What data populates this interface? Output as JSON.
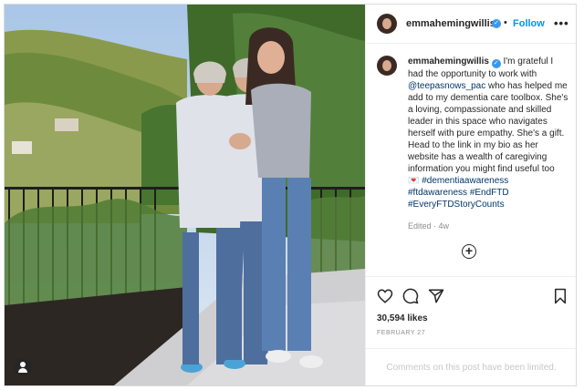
{
  "header": {
    "username": "emmahemingwillis",
    "separator": "•",
    "follow_label": "Follow",
    "more_label": "•••"
  },
  "caption": {
    "username": "emmahemingwillis",
    "line1": "I'm grateful I had the opportunity to work with",
    "mention": "@teepasnows_pac",
    "line2": "who has helped me add to my dementia care toolbox. She's a loving, compassionate and skilled leader in this space who navigates herself with pure empathy. She's a gift. Head to the link in my bio as her website has a wealth of caregiving information you might find useful too",
    "heart": "💌",
    "tag1": "#dementiaawareness",
    "tag2": "#ftdawareness",
    "tag3": "#EndFTD",
    "tag4": "#EveryFTDStoryCounts",
    "edited": "Edited · 4w"
  },
  "post": {
    "likes": "30,594 likes",
    "date": "FEBRUARY 27",
    "comments_limited": "Comments on this post have been limited."
  },
  "icons": {
    "verified": "verified-badge-icon",
    "add_comment": "plus-circle-icon",
    "like": "heart-icon",
    "comment": "comment-icon",
    "share": "paper-plane-icon",
    "save": "bookmark-icon",
    "tag": "user-tag-icon"
  },
  "colors": {
    "follow": "#0095f6",
    "link": "#00376b",
    "verified": "#3897f0",
    "muted": "#8e8e8e"
  }
}
